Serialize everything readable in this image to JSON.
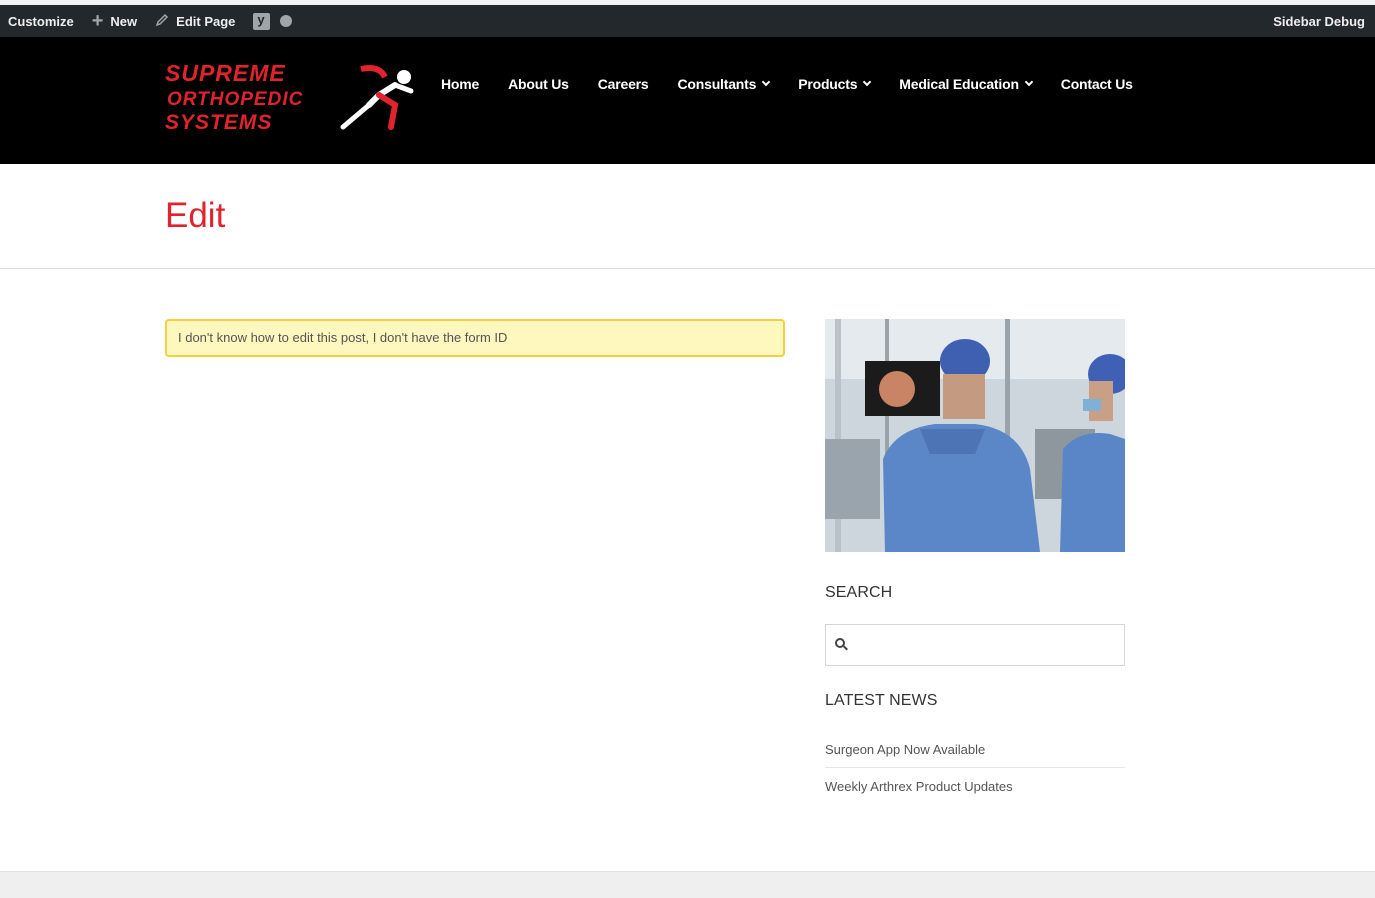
{
  "adminbar": {
    "customize": "Customize",
    "new": "New",
    "edit_page": "Edit Page",
    "sidebar_debug": "Sidebar Debug"
  },
  "logo": {
    "line1": "SUPREME",
    "line2": "ORTHOPEDIC",
    "line3": "SYSTEMS"
  },
  "nav": {
    "items": [
      {
        "label": "Home"
      },
      {
        "label": "About Us"
      },
      {
        "label": "Careers"
      },
      {
        "label": "Consultants"
      },
      {
        "label": "Products"
      },
      {
        "label": "Medical Education"
      },
      {
        "label": "Contact Us"
      }
    ]
  },
  "page": {
    "title": "Edit",
    "notice": "I don't know how to edit this post, I don't have the form ID"
  },
  "sidebar": {
    "search_title": "SEARCH",
    "search_placeholder": "",
    "news_title": "LATEST NEWS",
    "news": [
      {
        "label": "Surgeon App Now Available"
      },
      {
        "label": "Weekly Arthrex Product Updates"
      }
    ]
  },
  "colors": {
    "brand_red": "#e0232d",
    "header_bg": "#000000",
    "adminbar_bg": "#23282d",
    "notice_bg": "#fef7be",
    "notice_border": "#f5cf3e"
  }
}
